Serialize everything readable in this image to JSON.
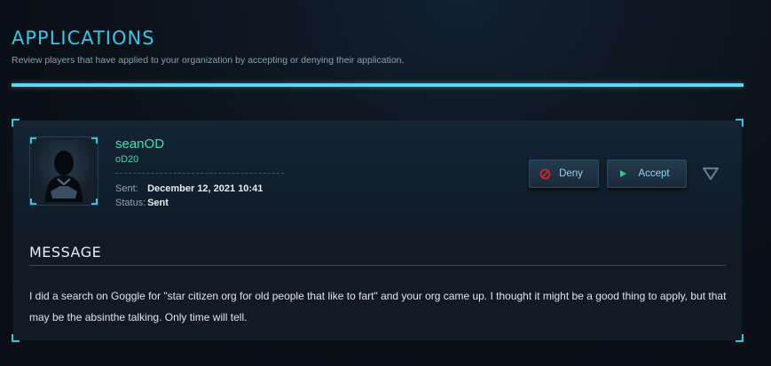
{
  "page": {
    "title": "APPLICATIONS",
    "subtitle": "Review players that have applied to your organization by accepting or denying their application."
  },
  "applicant": {
    "username": "seanOD",
    "handle": "oD20",
    "sent_label": "Sent:",
    "sent_value": "December 12, 2021 10:41",
    "status_label": "Status:",
    "status_value": "Sent"
  },
  "actions": {
    "deny_label": "Deny",
    "accept_label": "Accept",
    "deny_icon": "prohibit-icon",
    "accept_icon": "play-icon",
    "toggle_icon": "chevron-down-icon"
  },
  "message": {
    "heading": "MESSAGE",
    "body": "I did a search on Goggle for \"star citizen org for old people that like to fart\" and your org came up. I thought it might be a good thing to apply, but that may be the absinthe talking. Only time will tell."
  },
  "colors": {
    "accent": "#39c5e6",
    "username": "#3fe0b7",
    "deny": "#e0202c",
    "accept": "#28d07a"
  }
}
